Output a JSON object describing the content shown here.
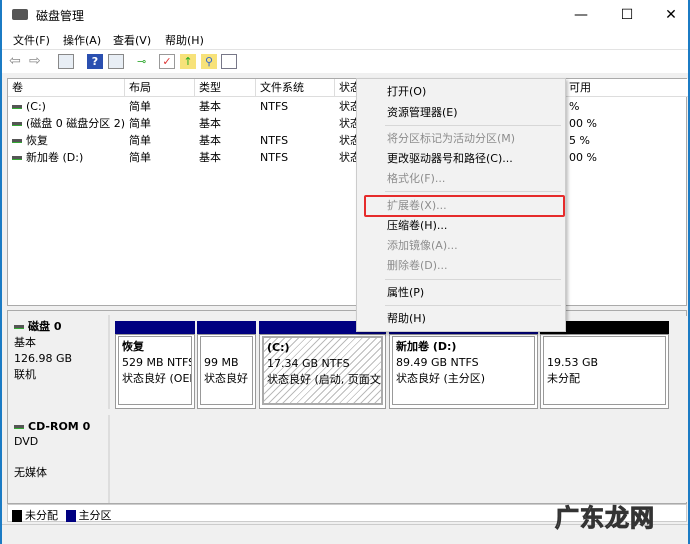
{
  "window": {
    "title": "磁盘管理",
    "minimize": "—",
    "maximize": "☐",
    "close": "✕"
  },
  "menu": [
    "文件(F)",
    "操作(A)",
    "查看(V)",
    "帮助(H)"
  ],
  "toolbar": [
    "back-icon",
    "forward-icon",
    "console-tree-icon",
    "help-icon",
    "action-pane-icon",
    "connect-icon",
    "checklist-icon",
    "folder-up-icon",
    "folder-search-icon",
    "properties-icon"
  ],
  "list": {
    "columns": [
      "卷",
      "布局",
      "类型",
      "文件系统",
      "状态",
      "",
      "",
      "可用"
    ],
    "rows": [
      {
        "vol": "(C:)",
        "layout": "简单",
        "type": "基本",
        "fs": "NTFS",
        "status": "状态",
        "free": "%"
      },
      {
        "vol": "(磁盘 0 磁盘分区 2)",
        "layout": "简单",
        "type": "基本",
        "fs": "",
        "status": "状态",
        "free": "00 %"
      },
      {
        "vol": "恢复",
        "layout": "简单",
        "type": "基本",
        "fs": "NTFS",
        "status": "状态",
        "free": "5 %"
      },
      {
        "vol": "新加卷 (D:)",
        "layout": "简单",
        "type": "基本",
        "fs": "NTFS",
        "status": "状态",
        "free": "00 %"
      }
    ]
  },
  "context_menu": {
    "items": [
      {
        "label": "打开(O)",
        "enabled": true
      },
      {
        "label": "资源管理器(E)",
        "enabled": true
      },
      {
        "label": "将分区标记为活动分区(M)",
        "enabled": false
      },
      {
        "label": "更改驱动器号和路径(C)...",
        "enabled": true
      },
      {
        "label": "格式化(F)...",
        "enabled": false
      },
      {
        "label": "扩展卷(X)...",
        "enabled": false,
        "highlighted": true
      },
      {
        "label": "压缩卷(H)...",
        "enabled": true
      },
      {
        "label": "添加镜像(A)...",
        "enabled": false
      },
      {
        "label": "删除卷(D)...",
        "enabled": false
      },
      {
        "label": "属性(P)",
        "enabled": true
      },
      {
        "label": "帮助(H)",
        "enabled": true
      }
    ]
  },
  "disk0": {
    "name": "磁盘 0",
    "type": "基本",
    "size": "126.98 GB",
    "state": "联机",
    "partitions": [
      {
        "name": "恢复",
        "size": "529 MB NTFS",
        "status": "状态良好 (OEM"
      },
      {
        "name": "",
        "size": "99 MB",
        "status": "状态良好"
      },
      {
        "name": "(C:)",
        "size": "17.34 GB NTFS",
        "status": "状态良好 (启动, 页面文件"
      },
      {
        "name": "新加卷  (D:)",
        "size": "89.49 GB NTFS",
        "status": "状态良好 (主分区)"
      },
      {
        "name": "",
        "size": "19.53 GB",
        "status": "未分配"
      }
    ]
  },
  "cdrom": {
    "name": "CD-ROM 0",
    "type": "DVD",
    "state": "无媒体"
  },
  "legend": [
    {
      "label": "未分配",
      "color": "#000000"
    },
    {
      "label": "主分区",
      "color": "#000080"
    }
  ],
  "watermark": "广东龙网"
}
